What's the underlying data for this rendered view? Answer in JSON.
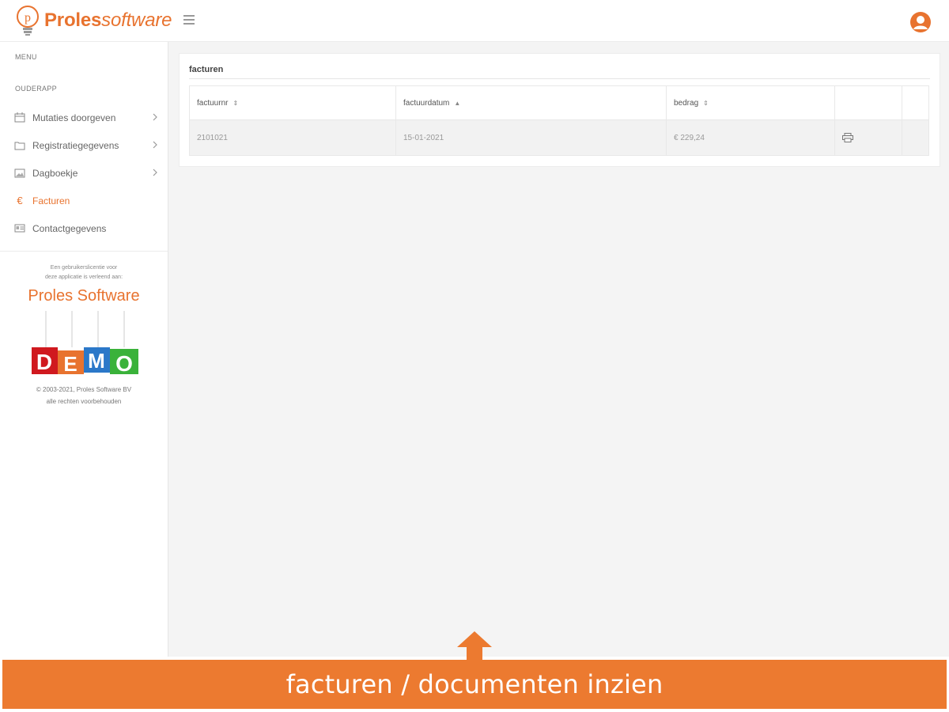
{
  "header": {
    "logo_main": "Proles",
    "logo_sub": "software",
    "logo_letter": "p"
  },
  "sidebar": {
    "menu_heading": "MENU",
    "app_heading": "OUDERAPP",
    "items": [
      {
        "label": "Mutaties doorgeven",
        "icon": "calendar-icon",
        "has_children": true
      },
      {
        "label": "Registratiegegevens",
        "icon": "folder-icon",
        "has_children": true
      },
      {
        "label": "Dagboekje",
        "icon": "image-icon",
        "has_children": true
      },
      {
        "label": "Facturen",
        "icon": "euro-icon",
        "has_children": false,
        "active": true
      },
      {
        "label": "Contactgegevens",
        "icon": "address-card-icon",
        "has_children": false
      }
    ],
    "note_line1": "Een gebruikerslicentie voor",
    "note_line2": "deze applicatie is verleend aan:",
    "brand": "Proles Software",
    "demo_letters": [
      "D",
      "E",
      "M",
      "O"
    ],
    "copyright_line1": "© 2003-2021, Proles Software BV",
    "copyright_line2": "alle rechten voorbehouden"
  },
  "invoices": {
    "title": "facturen",
    "columns": [
      "factuurnr",
      "factuurdatum",
      "bedrag"
    ],
    "sort_indicators": [
      "⇕",
      "▲",
      "⇕"
    ],
    "rows": [
      {
        "number": "2101021",
        "date": "15-01-2021",
        "amount": "€ 229,24"
      }
    ]
  },
  "banner": {
    "text": "facturen / documenten inzien"
  },
  "colors": {
    "accent": "#e8732f",
    "banner": "#ec7a30",
    "demo": [
      "#d0191f",
      "#e8732f",
      "#2b78c9",
      "#3ab23a"
    ]
  }
}
